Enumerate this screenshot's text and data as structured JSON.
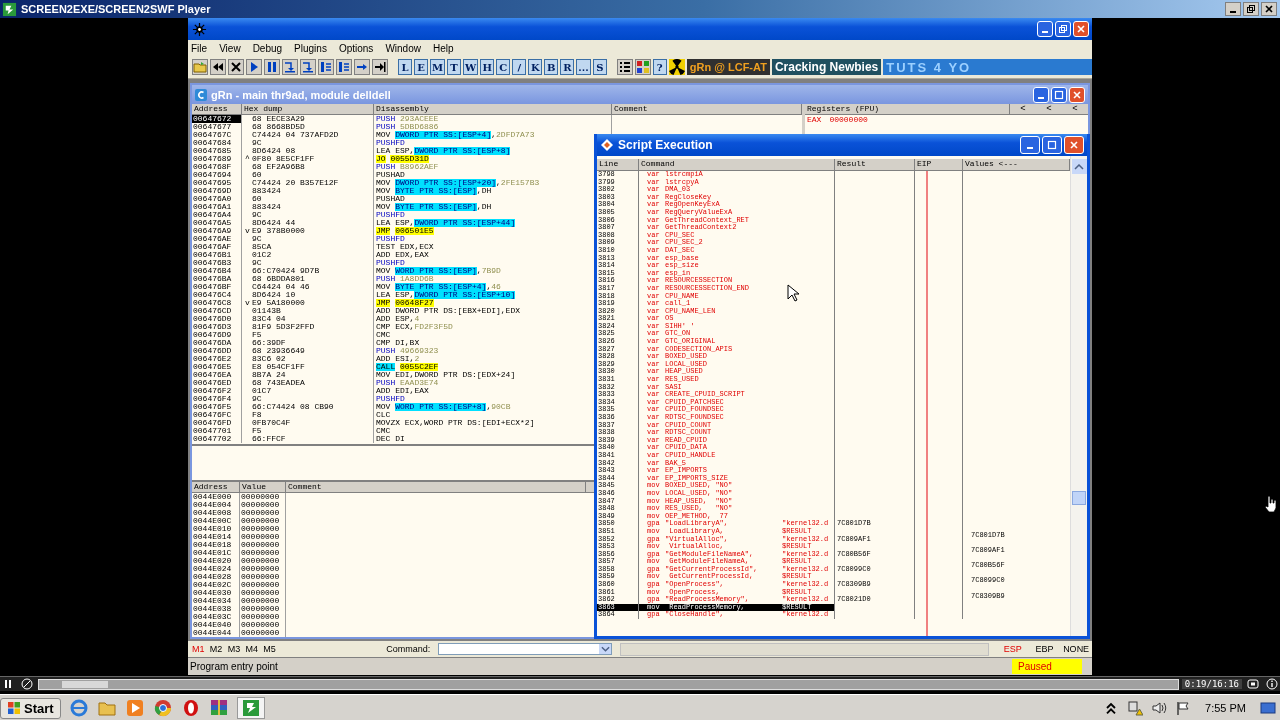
{
  "player": {
    "title": "SCREEN2EXE/SCREEN2SWF Player",
    "time": "0:19/16:16",
    "level": 0.02
  },
  "debugger": {
    "menu": [
      "File",
      "View",
      "Debug",
      "Plugins",
      "Options",
      "Window",
      "Help"
    ],
    "letters": [
      "L",
      "E",
      "M",
      "T",
      "W",
      "H",
      "C",
      "/",
      "K",
      "B",
      "R",
      "...",
      "S"
    ],
    "help": "?",
    "banners": [
      "gRn @ LCF-AT",
      "Cracking Newbies",
      "TUTS 4 YO"
    ]
  },
  "cpu_window": {
    "title": "gRn - main thr9ad, module delldell",
    "columns": [
      "Address",
      "Hex dump",
      "Disassembly",
      "Comment"
    ],
    "rows": [
      {
        "address": "00647672",
        "hex": "68 EECE3A29",
        "mnemonic": "PUSH",
        "kind": "stack",
        "operands": [
          {
            "kind": "const",
            "text": "293ACEEE"
          }
        ],
        "selected": true
      },
      {
        "address": "00647677",
        "hex": "68 8668BD5D",
        "mnemonic": "PUSH",
        "kind": "stack",
        "operands": [
          {
            "kind": "const",
            "text": "5DBD6886"
          }
        ],
        "selected": false
      },
      {
        "address": "0064767C",
        "hex": "C74424 04 737AFD2D",
        "mnemonic": "MOV",
        "kind": "plain",
        "operands": [
          {
            "kind": "mem",
            "text": "DWORD PTR SS:[ESP+4]"
          },
          {
            "kind": "plain",
            "text": ","
          },
          {
            "kind": "const",
            "text": "2DFD7A73"
          }
        ],
        "selected": false
      },
      {
        "address": "00647684",
        "hex": "9C",
        "mnemonic": "PUSHFD",
        "kind": "stack",
        "operands": [],
        "selected": false
      },
      {
        "address": "00647685",
        "hex": "8D6424 08",
        "mnemonic": "LEA",
        "kind": "plain",
        "operands": [
          {
            "kind": "plain",
            "text": "ESP,"
          },
          {
            "kind": "mem",
            "text": "DWORD PTR SS:[ESP+8]"
          }
        ],
        "selected": false
      },
      {
        "address": "00647689",
        "jump": "^",
        "hex": "0F80 8E5CF1FF",
        "mnemonic": "JO",
        "kind": "jump",
        "operands": [
          {
            "kind": "target",
            "text": "0055D31D"
          }
        ],
        "selected": false
      },
      {
        "address": "0064768F",
        "hex": "68 EF2A96B8",
        "mnemonic": "PUSH",
        "kind": "stack",
        "operands": [
          {
            "kind": "const",
            "text": "B8962AEF"
          }
        ],
        "selected": false
      },
      {
        "address": "00647694",
        "hex": "60",
        "mnemonic": "PUSHAD",
        "kind": "plain",
        "operands": [],
        "selected": false
      },
      {
        "address": "00647695",
        "hex": "C74424 20 B357E12F",
        "mnemonic": "MOV",
        "kind": "plain",
        "operands": [
          {
            "kind": "mem",
            "text": "DWORD PTR SS:[ESP+20]"
          },
          {
            "kind": "plain",
            "text": ","
          },
          {
            "kind": "const",
            "text": "2FE157B3"
          }
        ],
        "selected": false
      },
      {
        "address": "0064769D",
        "hex": "883424",
        "mnemonic": "MOV",
        "kind": "plain",
        "operands": [
          {
            "kind": "mem",
            "text": "BYTE PTR SS:[ESP]"
          },
          {
            "kind": "plain",
            "text": ",DH"
          }
        ],
        "selected": false
      },
      {
        "address": "006476A0",
        "hex": "60",
        "mnemonic": "PUSHAD",
        "kind": "plain",
        "operands": [],
        "selected": false
      },
      {
        "address": "006476A1",
        "hex": "883424",
        "mnemonic": "MOV",
        "kind": "plain",
        "operands": [
          {
            "kind": "mem",
            "text": "BYTE PTR SS:[ESP]"
          },
          {
            "kind": "plain",
            "text": ",DH"
          }
        ],
        "selected": false
      },
      {
        "address": "006476A4",
        "hex": "9C",
        "mnemonic": "PUSHFD",
        "kind": "stack",
        "operands": [],
        "selected": false
      },
      {
        "address": "006476A5",
        "hex": "8D6424 44",
        "mnemonic": "LEA",
        "kind": "plain",
        "operands": [
          {
            "kind": "plain",
            "text": "ESP,"
          },
          {
            "kind": "mem",
            "text": "DWORD PTR SS:[ESP+44]"
          }
        ],
        "selected": false
      },
      {
        "address": "006476A9",
        "jump": "v",
        "hex": "E9 378B0000",
        "mnemonic": "JMP",
        "kind": "jump",
        "operands": [
          {
            "kind": "target",
            "text": "006501E5"
          }
        ],
        "selected": false
      },
      {
        "address": "006476AE",
        "hex": "9C",
        "mnemonic": "PUSHFD",
        "kind": "stack",
        "operands": [],
        "selected": false
      },
      {
        "address": "006476AF",
        "hex": "85CA",
        "mnemonic": "TEST",
        "kind": "plain",
        "operands": [
          {
            "kind": "plain",
            "text": "EDX,ECX"
          }
        ],
        "selected": false
      },
      {
        "address": "006476B1",
        "hex": "01C2",
        "mnemonic": "ADD",
        "kind": "plain",
        "operands": [
          {
            "kind": "plain",
            "text": "EDX,EAX"
          }
        ],
        "selected": false
      },
      {
        "address": "006476B3",
        "hex": "9C",
        "mnemonic": "PUSHFD",
        "kind": "stack",
        "operands": [],
        "selected": false
      },
      {
        "address": "006476B4",
        "hex": "66:C70424 9D7B",
        "mnemonic": "MOV",
        "kind": "plain",
        "operands": [
          {
            "kind": "mem",
            "text": "WORD PTR SS:[ESP]"
          },
          {
            "kind": "plain",
            "text": ","
          },
          {
            "kind": "const",
            "text": "7B9D"
          }
        ],
        "selected": false
      },
      {
        "address": "006476BA",
        "hex": "68 6BDDA801",
        "mnemonic": "PUSH",
        "kind": "stack",
        "operands": [
          {
            "kind": "const",
            "text": "1A8DD6B"
          }
        ],
        "selected": false
      },
      {
        "address": "006476BF",
        "hex": "C64424 04 46",
        "mnemonic": "MOV",
        "kind": "plain",
        "operands": [
          {
            "kind": "mem",
            "text": "BYTE PTR SS:[ESP+4]"
          },
          {
            "kind": "plain",
            "text": ","
          },
          {
            "kind": "const",
            "text": "46"
          }
        ],
        "selected": false
      },
      {
        "address": "006476C4",
        "hex": "8D6424 10",
        "mnemonic": "LEA",
        "kind": "plain",
        "operands": [
          {
            "kind": "plain",
            "text": "ESP,"
          },
          {
            "kind": "mem",
            "text": "DWORD PTR SS:[ESP+10]"
          }
        ],
        "selected": false
      },
      {
        "address": "006476C8",
        "jump": "v",
        "hex": "E9 5A180000",
        "mnemonic": "JMP",
        "kind": "jump",
        "operands": [
          {
            "kind": "target",
            "text": "00648F27"
          }
        ],
        "selected": false
      },
      {
        "address": "006476CD",
        "hex": "01143B",
        "mnemonic": "ADD",
        "kind": "plain",
        "operands": [
          {
            "kind": "plain",
            "text": "DWORD PTR DS:[EBX+EDI],EDX"
          }
        ],
        "selected": false
      },
      {
        "address": "006476D0",
        "hex": "83C4 04",
        "mnemonic": "ADD",
        "kind": "plain",
        "operands": [
          {
            "kind": "plain",
            "text": "ESP,"
          },
          {
            "kind": "const",
            "text": "4"
          }
        ],
        "selected": false
      },
      {
        "address": "006476D3",
        "hex": "81F9 5D3F2FFD",
        "mnemonic": "CMP",
        "kind": "plain",
        "operands": [
          {
            "kind": "plain",
            "text": "ECX,"
          },
          {
            "kind": "const",
            "text": "FD2F3F5D"
          }
        ],
        "selected": false
      },
      {
        "address": "006476D9",
        "hex": "F5",
        "mnemonic": "CMC",
        "kind": "plain",
        "operands": [],
        "selected": false
      },
      {
        "address": "006476DA",
        "hex": "66:39DF",
        "mnemonic": "CMP",
        "kind": "plain",
        "operands": [
          {
            "kind": "plain",
            "text": "DI,BX"
          }
        ],
        "selected": false
      },
      {
        "address": "006476DD",
        "hex": "68 23936649",
        "mnemonic": "PUSH",
        "kind": "stack",
        "operands": [
          {
            "kind": "const",
            "text": "49669323"
          }
        ],
        "selected": false
      },
      {
        "address": "006476E2",
        "hex": "83C6 02",
        "mnemonic": "ADD",
        "kind": "plain",
        "operands": [
          {
            "kind": "plain",
            "text": "ESI,"
          },
          {
            "kind": "const",
            "text": "2"
          }
        ],
        "selected": false
      },
      {
        "address": "006476E5",
        "hex": "E8 054CF1FF",
        "mnemonic": "CALL",
        "kind": "call",
        "operands": [
          {
            "kind": "target",
            "text": "0055C2EF"
          }
        ],
        "selected": false
      },
      {
        "address": "006476EA",
        "hex": "8B7A 24",
        "mnemonic": "MOV",
        "kind": "plain",
        "operands": [
          {
            "kind": "plain",
            "text": "EDI,DWORD PTR DS:[EDX+24]"
          }
        ],
        "selected": false
      },
      {
        "address": "006476ED",
        "hex": "68 743EADEA",
        "mnemonic": "PUSH",
        "kind": "stack",
        "operands": [
          {
            "kind": "const",
            "text": "EAAD3E74"
          }
        ],
        "selected": false
      },
      {
        "address": "006476F2",
        "hex": "01C7",
        "mnemonic": "ADD",
        "kind": "plain",
        "operands": [
          {
            "kind": "plain",
            "text": "EDI,EAX"
          }
        ],
        "selected": false
      },
      {
        "address": "006476F4",
        "hex": "9C",
        "mnemonic": "PUSHFD",
        "kind": "stack",
        "operands": [],
        "selected": false
      },
      {
        "address": "006476F5",
        "hex": "66:C74424 08 CB90",
        "mnemonic": "MOV",
        "kind": "plain",
        "operands": [
          {
            "kind": "mem",
            "text": "WORD PTR SS:[ESP+8]"
          },
          {
            "kind": "plain",
            "text": ","
          },
          {
            "kind": "const",
            "text": "90CB"
          }
        ],
        "selected": false
      },
      {
        "address": "006476FC",
        "hex": "F8",
        "mnemonic": "CLC",
        "kind": "plain",
        "operands": [],
        "selected": false
      },
      {
        "address": "006476FD",
        "hex": "0FB70C4F",
        "mnemonic": "MOVZX",
        "kind": "plain",
        "operands": [
          {
            "kind": "plain",
            "text": "ECX,WORD PTR DS:[EDI+ECX*2]"
          }
        ],
        "selected": false
      },
      {
        "address": "00647701",
        "hex": "F5",
        "mnemonic": "CMC",
        "kind": "plain",
        "operands": [],
        "selected": false
      },
      {
        "address": "00647702",
        "hex": "66:FFCF",
        "mnemonic": "DEC",
        "kind": "plain",
        "operands": [
          {
            "kind": "plain",
            "text": "DI"
          }
        ],
        "selected": false
      }
    ],
    "registers": {
      "title": "Registers (FPU)",
      "arrows": [
        "<",
        "<",
        "<"
      ],
      "rows": [
        {
          "name": "EAX",
          "value": "00000000"
        }
      ]
    },
    "stack_columns": [
      "Address",
      "Value",
      "Comment"
    ],
    "stack_rows": [
      {
        "address": "0044E000",
        "value": "00000000"
      },
      {
        "address": "0044E004",
        "value": "00000000"
      },
      {
        "address": "0044E008",
        "value": "00000000"
      },
      {
        "address": "0044E00C",
        "value": "00000000"
      },
      {
        "address": "0044E010",
        "value": "00000000"
      },
      {
        "address": "0044E014",
        "value": "00000000"
      },
      {
        "address": "0044E018",
        "value": "00000000"
      },
      {
        "address": "0044E01C",
        "value": "00000000"
      },
      {
        "address": "0044E020",
        "value": "00000000"
      },
      {
        "address": "0044E024",
        "value": "00000000"
      },
      {
        "address": "0044E028",
        "value": "00000000"
      },
      {
        "address": "0044E02C",
        "value": "00000000"
      },
      {
        "address": "0044E030",
        "value": "00000000"
      },
      {
        "address": "0044E034",
        "value": "00000000"
      },
      {
        "address": "0044E038",
        "value": "00000000"
      },
      {
        "address": "0044E03C",
        "value": "00000000"
      },
      {
        "address": "0044E040",
        "value": "00000000"
      },
      {
        "address": "0044E044",
        "value": "00000000"
      }
    ]
  },
  "script_window": {
    "title": "Script Execution",
    "columns": [
      "Line",
      "Command",
      "Result",
      "EIP",
      "Values <---"
    ],
    "rows": [
      {
        "line": "3798",
        "op": "var",
        "args": "lstrcmpiA",
        "selected": false
      },
      {
        "line": "3799",
        "op": "var",
        "args": "lstrcpyA",
        "selected": false
      },
      {
        "line": "3802",
        "op": "var",
        "args": "DMA_03",
        "selected": false
      },
      {
        "line": "3803",
        "op": "var",
        "args": "RegCloseKey",
        "selected": false
      },
      {
        "line": "3804",
        "op": "var",
        "args": "RegOpenKeyExA",
        "selected": false
      },
      {
        "line": "3805",
        "op": "var",
        "args": "RegQueryValueExA",
        "selected": false
      },
      {
        "line": "3806",
        "op": "var",
        "args": "GetThreadContext_RET",
        "selected": false
      },
      {
        "line": "3807",
        "op": "var",
        "args": "GetThreadContext2",
        "selected": false
      },
      {
        "line": "3808",
        "op": "var",
        "args": "CPU_SEC",
        "selected": false
      },
      {
        "line": "3809",
        "op": "var",
        "args": "CPU_SEC_2",
        "selected": false
      },
      {
        "line": "3810",
        "op": "var",
        "args": "DAT_SEC",
        "selected": false
      },
      {
        "line": "3813",
        "op": "var",
        "args": "esp_base",
        "selected": false
      },
      {
        "line": "3814",
        "op": "var",
        "args": "esp_size",
        "selected": false
      },
      {
        "line": "3815",
        "op": "var",
        "args": "esp_in",
        "selected": false
      },
      {
        "line": "3816",
        "op": "var",
        "args": "RESOURCESSECTION",
        "selected": false
      },
      {
        "line": "3817",
        "op": "var",
        "args": "RESOURCESSECTION_END",
        "selected": false
      },
      {
        "line": "3818",
        "op": "var",
        "args": "CPU_NAME",
        "selected": false
      },
      {
        "line": "3819",
        "op": "var",
        "args": "call_1",
        "selected": false
      },
      {
        "line": "3820",
        "op": "var",
        "args": "CPU_NAME_LEN",
        "selected": false
      },
      {
        "line": "3821",
        "op": "var",
        "args": "OS",
        "selected": false
      },
      {
        "line": "3824",
        "op": "var",
        "args": "SIHH' '",
        "selected": false
      },
      {
        "line": "3825",
        "op": "var",
        "args": "GTC_ON",
        "selected": false
      },
      {
        "line": "3826",
        "op": "var",
        "args": "GTC_ORIGINAL",
        "selected": false
      },
      {
        "line": "3827",
        "op": "var",
        "args": "CODESECTION_APIS",
        "selected": false
      },
      {
        "line": "3828",
        "op": "var",
        "args": "BOXED_USED",
        "selected": false
      },
      {
        "line": "3829",
        "op": "var",
        "args": "LOCAL_USED",
        "selected": false
      },
      {
        "line": "3830",
        "op": "var",
        "args": "HEAP_USED",
        "selected": false
      },
      {
        "line": "3831",
        "op": "var",
        "args": "RES_USED",
        "selected": false
      },
      {
        "line": "3832",
        "op": "var",
        "args": "SASI",
        "selected": false
      },
      {
        "line": "3833",
        "op": "var",
        "args": "CREATE_CPUID_SCRIPT",
        "selected": false
      },
      {
        "line": "3834",
        "op": "var",
        "args": "CPUID_PATCHSEC",
        "selected": false
      },
      {
        "line": "3835",
        "op": "var",
        "args": "CPUID_FOUNDSEC",
        "selected": false
      },
      {
        "line": "3836",
        "op": "var",
        "args": "RDTSC_FOUNDSEC",
        "selected": false
      },
      {
        "line": "3837",
        "op": "var",
        "args": "CPUID_COUNT",
        "selected": false
      },
      {
        "line": "3838",
        "op": "var",
        "args": "RDTSC_COUNT",
        "selected": false
      },
      {
        "line": "3839",
        "op": "var",
        "args": "READ_CPUID",
        "selected": false
      },
      {
        "line": "3840",
        "op": "var",
        "args": "CPUID_DATA",
        "selected": false
      },
      {
        "line": "3841",
        "op": "var",
        "args": "CPUID_HANDLE",
        "selected": false
      },
      {
        "line": "3842",
        "op": "var",
        "args": "BAK_5",
        "selected": false
      },
      {
        "line": "3843",
        "op": "var",
        "args": "EP_IMPORTS",
        "selected": false
      },
      {
        "line": "3844",
        "op": "var",
        "args": "EP_IMPORTS_SIZE",
        "selected": false
      },
      {
        "line": "3845",
        "op": "mov",
        "args": "BOXED_USED, \"NO\"",
        "selected": false
      },
      {
        "line": "3846",
        "op": "mov",
        "args": "LOCAL_USED, \"NO\"",
        "selected": false
      },
      {
        "line": "3847",
        "op": "mov",
        "args": "HEAP_USED,  \"NO\"",
        "selected": false
      },
      {
        "line": "3848",
        "op": "mov",
        "args": "RES_USED,   \"NO\"",
        "selected": false
      },
      {
        "line": "3849",
        "op": "mov",
        "args": "OEP_METHOD,  77",
        "selected": false
      },
      {
        "line": "3850",
        "op": "gpa",
        "args": "\"LoadLibraryA\",",
        "arg2": "\"kernel32.d",
        "result": "7C801D7B",
        "selected": false
      },
      {
        "line": "3851",
        "op": "mov",
        "args": " LoadLibraryA,",
        "arg2": "$RESULT",
        "value": "7C801D7B",
        "selected": false
      },
      {
        "line": "3852",
        "op": "gpa",
        "args": "\"VirtualAlloc\",",
        "arg2": "\"kernel32.d",
        "result": "7C809AF1",
        "selected": false
      },
      {
        "line": "3853",
        "op": "mov",
        "args": " VirtualAlloc,",
        "arg2": "$RESULT",
        "value": "7C809AF1",
        "selected": false
      },
      {
        "line": "3856",
        "op": "gpa",
        "args": "\"GetModuleFileNameA\",",
        "arg2": "\"kernel32.d",
        "result": "7C80B56F",
        "selected": false
      },
      {
        "line": "3857",
        "op": "mov",
        "args": " GetModuleFileNameA,",
        "arg2": "$RESULT",
        "value": "7C80B56F",
        "selected": false
      },
      {
        "line": "3858",
        "op": "gpa",
        "args": "\"GetCurrentProcessId\",",
        "arg2": "\"kernel32.d",
        "result": "7C8099C0",
        "selected": false
      },
      {
        "line": "3859",
        "op": "mov",
        "args": " GetCurrentProcessId,",
        "arg2": "$RESULT",
        "value": "7C8099C0",
        "selected": false
      },
      {
        "line": "3860",
        "op": "gpa",
        "args": "\"OpenProcess\",",
        "arg2": "\"kernel32.d",
        "result": "7C8309B9",
        "selected": false
      },
      {
        "line": "3861",
        "op": "mov",
        "args": " OpenProcess,",
        "arg2": "$RESULT",
        "value": "7C8309B9",
        "selected": false
      },
      {
        "line": "3862",
        "op": "gpa",
        "args": "\"ReadProcessMemory\",",
        "arg2": "\"kernel32.d",
        "result": "7C8021D0",
        "selected": false
      },
      {
        "line": "3863",
        "op": "mov",
        "args": " ReadProcessMemory,",
        "arg2": "$RESULT",
        "selected": true
      },
      {
        "line": "3864",
        "op": "gpa",
        "args": "\"CloseHandle\",",
        "arg2": "\"kernel32.d",
        "selected": false
      }
    ]
  },
  "bottom_bar": {
    "marks": [
      {
        "label": "M1",
        "selected": true
      },
      {
        "label": "M2",
        "selected": false
      },
      {
        "label": "M3",
        "selected": false
      },
      {
        "label": "M4",
        "selected": false
      },
      {
        "label": "M5",
        "selected": false
      }
    ],
    "command_label": "Command:",
    "registers": [
      {
        "label": "ESP",
        "selected": true
      },
      {
        "label": "EBP",
        "selected": false
      },
      {
        "label": "NONE",
        "selected": false
      }
    ]
  },
  "status": {
    "message": "Program entry point",
    "state": "Paused"
  },
  "taskbar": {
    "start": "Start",
    "clock": "7:55 PM"
  }
}
